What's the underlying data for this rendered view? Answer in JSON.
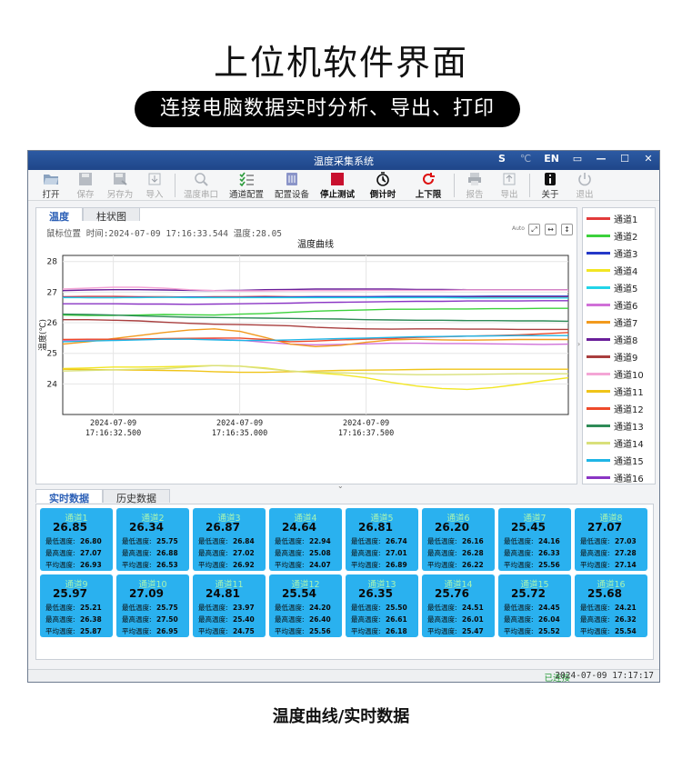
{
  "page": {
    "title": "上位机软件界面",
    "subtitle": "连接电脑数据实时分析、导出、打印",
    "caption": "温度曲线/实时数据"
  },
  "window": {
    "title": "温度采集系统",
    "right_controls": [
      "S",
      "℃",
      "EN",
      "▭",
      "—",
      "☐",
      "✕"
    ]
  },
  "toolbar": [
    {
      "label": "打开",
      "icon": "folder-open-icon",
      "enabled": true
    },
    {
      "label": "保存",
      "icon": "save-icon",
      "enabled": false
    },
    {
      "label": "另存为",
      "icon": "save-as-icon",
      "enabled": false
    },
    {
      "label": "导入",
      "icon": "import-icon",
      "enabled": false
    },
    {
      "label": "温度串口",
      "icon": "serial-port-icon",
      "enabled": false
    },
    {
      "label": "通道配置",
      "icon": "channel-config-icon",
      "enabled": true
    },
    {
      "label": "配置设备",
      "icon": "device-config-icon",
      "enabled": true
    },
    {
      "label": "停止测试",
      "icon": "stop-icon",
      "enabled": true
    },
    {
      "label": "倒计时",
      "icon": "timer-icon",
      "enabled": true
    },
    {
      "label": "上下限",
      "icon": "limits-icon",
      "enabled": true
    },
    {
      "label": "报告",
      "icon": "report-icon",
      "enabled": false
    },
    {
      "label": "导出",
      "icon": "export-icon",
      "enabled": false
    },
    {
      "label": "关于",
      "icon": "info-icon",
      "enabled": true
    },
    {
      "label": "退出",
      "icon": "power-icon",
      "enabled": false
    }
  ],
  "chart_tabs": [
    "温度",
    "柱状图"
  ],
  "readout": "鼠标位置 时间:2024-07-09 17:16:33.544 温度:28.05",
  "chart_data": {
    "type": "line",
    "title": "温度曲线",
    "ylabel": "温度(℃)",
    "xlabel": "",
    "ylim": [
      23.0,
      28.2
    ],
    "yticks": [
      24,
      25,
      26,
      27,
      28
    ],
    "xticks": [
      {
        "t": 1.0,
        "label": "2024-07-09\n17:16:32.500"
      },
      {
        "t": 3.5,
        "label": "2024-07-09\n17:16:35.000"
      },
      {
        "t": 6.0,
        "label": "2024-07-09\n17:16:37.500"
      }
    ],
    "xlim": [
      0.0,
      10.0
    ],
    "grid": true,
    "legend": "right",
    "x": [
      0,
      0.5,
      1,
      1.5,
      2,
      2.5,
      3,
      3.5,
      4,
      4.5,
      5,
      5.5,
      6,
      6.5,
      7,
      7.5,
      8,
      8.5,
      9,
      9.5,
      10
    ],
    "series": [
      {
        "name": "通道1",
        "color": "#e23a3a",
        "values": [
          26.85,
          26.86,
          26.86,
          26.85,
          26.85,
          26.84,
          26.85,
          26.85,
          26.86,
          26.85,
          26.85,
          26.85,
          26.85,
          26.85,
          26.85,
          26.85,
          26.85,
          26.85,
          26.85,
          26.85,
          26.85
        ]
      },
      {
        "name": "通道2",
        "color": "#3bd13b",
        "values": [
          26.25,
          26.24,
          26.24,
          26.25,
          26.27,
          26.26,
          26.25,
          26.28,
          26.3,
          26.34,
          26.38,
          26.4,
          26.42,
          26.44,
          26.44,
          26.45,
          26.45,
          26.46,
          26.46,
          26.47,
          26.47
        ]
      },
      {
        "name": "通道3",
        "color": "#2438c8",
        "values": [
          26.83,
          26.82,
          26.82,
          26.83,
          26.83,
          26.84,
          26.83,
          26.83,
          26.84,
          26.84,
          26.85,
          26.85,
          26.85,
          26.86,
          26.86,
          26.86,
          26.86,
          26.87,
          26.87,
          26.87,
          26.87
        ]
      },
      {
        "name": "通道4",
        "color": "#f2e623",
        "values": [
          24.5,
          24.52,
          24.55,
          24.55,
          24.56,
          24.58,
          24.6,
          24.58,
          24.52,
          24.42,
          24.36,
          24.3,
          24.2,
          24.05,
          23.93,
          23.85,
          23.82,
          23.88,
          23.98,
          24.1,
          24.2
        ]
      },
      {
        "name": "通道5",
        "color": "#22d4e8",
        "values": [
          26.82,
          26.82,
          26.82,
          26.82,
          26.83,
          26.82,
          26.82,
          26.82,
          26.82,
          26.82,
          26.82,
          26.82,
          26.82,
          26.82,
          26.82,
          26.82,
          26.81,
          26.81,
          26.81,
          26.81,
          26.81
        ]
      },
      {
        "name": "通道6",
        "color": "#d070d8",
        "values": [
          25.42,
          25.44,
          25.46,
          25.45,
          25.46,
          25.47,
          25.46,
          25.43,
          25.36,
          25.3,
          25.28,
          25.29,
          25.31,
          25.33,
          25.33,
          25.32,
          25.32,
          25.31,
          25.3,
          25.29,
          25.3
        ]
      },
      {
        "name": "通道7",
        "color": "#f29a1d",
        "values": [
          25.3,
          25.38,
          25.48,
          25.58,
          25.68,
          25.76,
          25.8,
          25.72,
          25.52,
          25.3,
          25.22,
          25.26,
          25.36,
          25.44,
          25.46,
          25.44,
          25.43,
          25.44,
          25.45,
          25.45,
          25.45
        ]
      },
      {
        "name": "通道8",
        "color": "#6a1f9a",
        "values": [
          27.05,
          27.07,
          27.08,
          27.08,
          27.07,
          27.06,
          27.05,
          27.06,
          27.08,
          27.09,
          27.1,
          27.1,
          27.1,
          27.1,
          27.09,
          27.09,
          27.08,
          27.08,
          27.08,
          27.08,
          27.08
        ]
      },
      {
        "name": "通道9",
        "color": "#a93e3e",
        "values": [
          26.1,
          26.1,
          26.08,
          26.06,
          26.02,
          25.98,
          25.95,
          25.94,
          25.92,
          25.9,
          25.85,
          25.82,
          25.8,
          25.79,
          25.8,
          25.8,
          25.79,
          25.79,
          25.78,
          25.78,
          25.78
        ]
      },
      {
        "name": "通道10",
        "color": "#f4a6d6",
        "values": [
          27.1,
          27.13,
          27.16,
          27.16,
          27.13,
          27.08,
          27.05,
          27.04,
          27.04,
          27.05,
          27.05,
          27.05,
          27.06,
          27.06,
          27.06,
          27.06,
          27.07,
          27.07,
          27.07,
          27.07,
          27.07
        ]
      },
      {
        "name": "通道11",
        "color": "#f0c419",
        "values": [
          24.48,
          24.47,
          24.46,
          24.45,
          24.44,
          24.43,
          24.4,
          24.38,
          24.38,
          24.4,
          24.42,
          24.44,
          24.45,
          24.46,
          24.47,
          24.48,
          24.48,
          24.48,
          24.48,
          24.48,
          24.48
        ]
      },
      {
        "name": "通道12",
        "color": "#ee4a2a",
        "values": [
          25.45,
          25.46,
          25.46,
          25.47,
          25.48,
          25.49,
          25.5,
          25.5,
          25.45,
          25.38,
          25.4,
          25.44,
          25.46,
          25.48,
          25.52,
          25.54,
          25.56,
          25.58,
          25.6,
          25.64,
          25.68
        ]
      },
      {
        "name": "通道13",
        "color": "#2e8b57",
        "values": [
          26.28,
          26.27,
          26.25,
          26.22,
          26.2,
          26.18,
          26.17,
          26.16,
          26.15,
          26.14,
          26.13,
          26.12,
          26.1,
          26.09,
          26.08,
          26.08,
          26.07,
          26.07,
          26.06,
          26.06,
          26.05
        ]
      },
      {
        "name": "通道14",
        "color": "#d9e07a",
        "values": [
          24.42,
          24.44,
          24.46,
          24.48,
          24.5,
          24.55,
          24.6,
          24.58,
          24.5,
          24.42,
          24.38,
          24.36,
          24.34,
          24.32,
          24.3,
          24.3,
          24.31,
          24.32,
          24.33,
          24.33,
          24.33
        ]
      },
      {
        "name": "通道15",
        "color": "#1fb5e6",
        "values": [
          25.38,
          25.4,
          25.42,
          25.44,
          25.46,
          25.46,
          25.44,
          25.42,
          25.42,
          25.44,
          25.46,
          25.48,
          25.5,
          25.52,
          25.54,
          25.55,
          25.56,
          25.57,
          25.58,
          25.58,
          25.58
        ]
      },
      {
        "name": "通道16",
        "color": "#8a35c4",
        "values": [
          26.62,
          26.62,
          26.62,
          26.61,
          26.61,
          26.6,
          26.61,
          26.62,
          26.63,
          26.64,
          26.66,
          26.67,
          26.68,
          26.69,
          26.7,
          26.7,
          26.71,
          26.71,
          26.71,
          26.72,
          26.72
        ]
      }
    ]
  },
  "data_tabs": [
    "实时数据",
    "历史数据"
  ],
  "labels": {
    "min": "最低温度:",
    "max": "最高温度:",
    "avg": "平均温度:"
  },
  "cards": [
    {
      "name": "通道1",
      "current": "26.85",
      "min": "26.80",
      "max": "27.07",
      "avg": "26.93"
    },
    {
      "name": "通道2",
      "current": "26.34",
      "min": "25.75",
      "max": "26.88",
      "avg": "26.53"
    },
    {
      "name": "通道3",
      "current": "26.87",
      "min": "26.84",
      "max": "27.02",
      "avg": "26.92"
    },
    {
      "name": "通道4",
      "current": "24.64",
      "min": "22.94",
      "max": "25.08",
      "avg": "24.07"
    },
    {
      "name": "通道5",
      "current": "26.81",
      "min": "26.74",
      "max": "27.01",
      "avg": "26.89"
    },
    {
      "name": "通道6",
      "current": "26.20",
      "min": "26.16",
      "max": "26.28",
      "avg": "26.22"
    },
    {
      "name": "通道7",
      "current": "25.45",
      "min": "24.16",
      "max": "26.33",
      "avg": "25.56"
    },
    {
      "name": "通道8",
      "current": "27.07",
      "min": "27.03",
      "max": "27.28",
      "avg": "27.14"
    },
    {
      "name": "通道9",
      "current": "25.97",
      "min": "25.21",
      "max": "26.38",
      "avg": "25.87"
    },
    {
      "name": "通道10",
      "current": "27.09",
      "min": "25.75",
      "max": "27.50",
      "avg": "26.95"
    },
    {
      "name": "通道11",
      "current": "24.81",
      "min": "23.97",
      "max": "25.40",
      "avg": "24.75"
    },
    {
      "name": "通道12",
      "current": "25.54",
      "min": "24.20",
      "max": "26.40",
      "avg": "25.56"
    },
    {
      "name": "通道13",
      "current": "26.35",
      "min": "25.50",
      "max": "26.61",
      "avg": "26.18"
    },
    {
      "name": "通道14",
      "current": "25.76",
      "min": "24.51",
      "max": "26.01",
      "avg": "25.47"
    },
    {
      "name": "通道15",
      "current": "25.72",
      "min": "24.45",
      "max": "26.04",
      "avg": "25.52"
    },
    {
      "name": "通道16",
      "current": "25.68",
      "min": "24.21",
      "max": "26.32",
      "avg": "25.54"
    }
  ],
  "status": {
    "connection": "已连接",
    "datetime": "2024-07-09 17:17:17"
  }
}
